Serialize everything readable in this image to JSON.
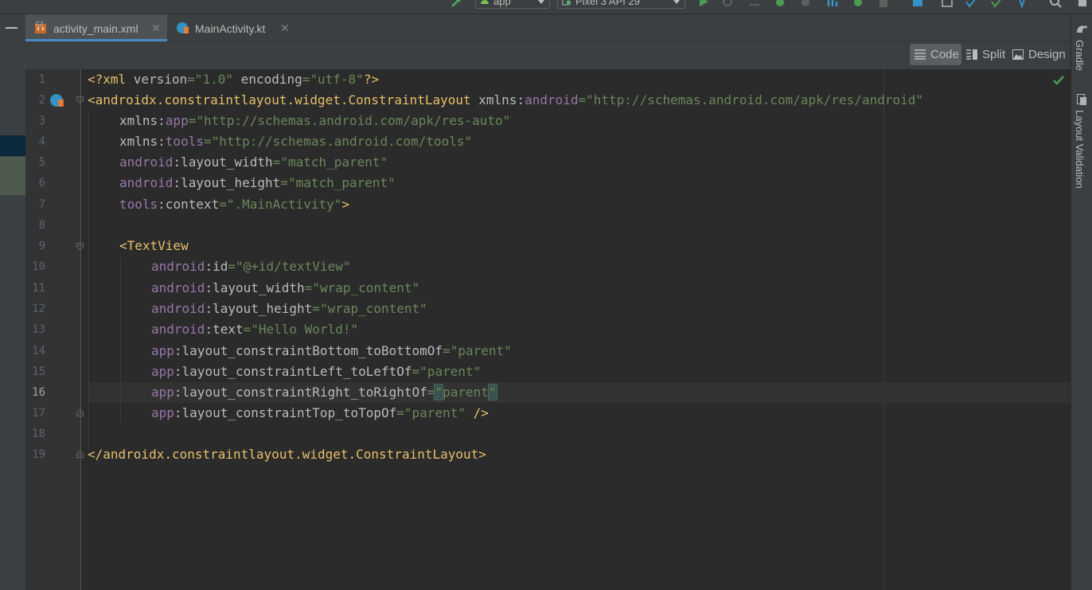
{
  "toolbar": {
    "run_config": "app",
    "device": "Pixel 3 API 29"
  },
  "tabs": [
    {
      "label": "activity_main.xml",
      "active": true,
      "icon": "xml-layout-icon"
    },
    {
      "label": "MainActivity.kt",
      "active": false,
      "icon": "kotlin-class-icon"
    }
  ],
  "editor_modes": {
    "code": "Code",
    "split": "Split",
    "design": "Design",
    "selected": "Code"
  },
  "right_tools": {
    "gradle": "Gradle",
    "layout_validation": "Layout Validation"
  },
  "editor": {
    "current_line": 16,
    "line_numbers": [
      "1",
      "2",
      "3",
      "4",
      "5",
      "6",
      "7",
      "8",
      "9",
      "10",
      "11",
      "12",
      "13",
      "14",
      "15",
      "16",
      "17",
      "18",
      "19"
    ],
    "lines": {
      "l1": [
        "<?xml ",
        "version",
        "=",
        "\"1.0\"",
        " encoding",
        "=",
        "\"utf-8\"",
        "?>"
      ],
      "l2": [
        "<androidx.constraintlayout.widget.ConstraintLayout ",
        "xmlns:",
        "android",
        "=",
        "\"http://schemas.android.com/apk/res/android\""
      ],
      "l3": [
        "xmlns:",
        "app",
        "=",
        "\"http://schemas.android.com/apk/res-auto\""
      ],
      "l4": [
        "xmlns:",
        "tools",
        "=",
        "\"http://schemas.android.com/tools\""
      ],
      "l5": [
        "android",
        ":layout_width",
        "=",
        "\"match_parent\""
      ],
      "l6": [
        "android",
        ":layout_height",
        "=",
        "\"match_parent\""
      ],
      "l7": [
        "tools",
        ":context",
        "=",
        "\".MainActivity\"",
        ">"
      ],
      "l9": [
        "<TextView"
      ],
      "l10": [
        "android",
        ":id",
        "=",
        "\"@+id/textView\""
      ],
      "l11": [
        "android",
        ":layout_width",
        "=",
        "\"wrap_content\""
      ],
      "l12": [
        "android",
        ":layout_height",
        "=",
        "\"wrap_content\""
      ],
      "l13": [
        "android",
        ":text",
        "=",
        "\"Hello World!\""
      ],
      "l14": [
        "app",
        ":layout_constraintBottom_toBottomOf",
        "=",
        "\"parent\""
      ],
      "l15": [
        "app",
        ":layout_constraintLeft_toLeftOf",
        "=",
        "\"parent\""
      ],
      "l16": [
        "app",
        ":layout_constraintRight_toRightOf",
        "=",
        "\"",
        "parent",
        "\""
      ],
      "l17": [
        "app",
        ":layout_constraintTop_toTopOf",
        "=",
        "\"parent\"",
        " />"
      ],
      "l19": [
        "</androidx.constraintlayout.widget.ConstraintLayout>"
      ]
    }
  },
  "colors": {
    "tag": "#e8bf6a",
    "namespace": "#9876aa",
    "string": "#6a8759",
    "attribute": "#bababa",
    "background": "#2b2b2b",
    "accent": "#4a88c7"
  }
}
